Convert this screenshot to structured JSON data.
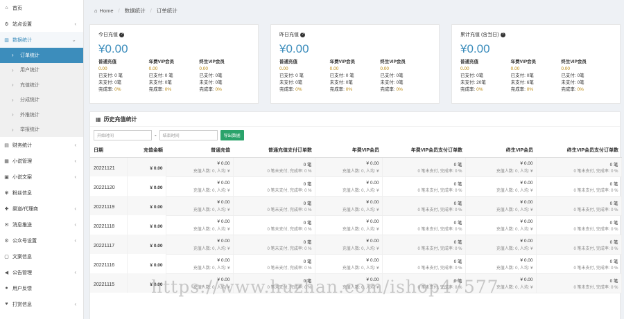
{
  "sidebar": {
    "items": [
      {
        "icon": "house-icon",
        "glyph": "⌂",
        "label": "首页",
        "arrow": ""
      },
      {
        "icon": "gear-icon",
        "glyph": "⚙",
        "label": "站点设置",
        "arrow": "‹"
      },
      {
        "icon": "bar-chart-icon",
        "glyph": "▥",
        "label": "数据统计",
        "arrow": "⌄",
        "active": true
      }
    ],
    "sub_items": [
      {
        "label": "订单统计",
        "active": true
      },
      {
        "label": "用户统计"
      },
      {
        "label": "充值统计"
      },
      {
        "label": "分成统计"
      },
      {
        "label": "外推统计"
      },
      {
        "label": "举报统计"
      }
    ],
    "items_after": [
      {
        "icon": "finance-icon",
        "glyph": "▤",
        "label": "财务统计",
        "arrow": "‹"
      },
      {
        "icon": "book-icon",
        "glyph": "▦",
        "label": "小说管理",
        "arrow": "‹"
      },
      {
        "icon": "document-icon",
        "glyph": "▣",
        "label": "小说文案",
        "arrow": "‹"
      },
      {
        "icon": "fans-icon",
        "glyph": "✾",
        "label": "粉丝信息",
        "arrow": ""
      },
      {
        "icon": "user-plus-icon",
        "glyph": "✚",
        "label": "渠道/代理商",
        "arrow": "‹"
      },
      {
        "icon": "chat-icon",
        "glyph": "✉",
        "label": "消息推送",
        "arrow": "‹"
      },
      {
        "icon": "gears-icon",
        "glyph": "⚙",
        "label": "公众号设置",
        "arrow": "‹"
      },
      {
        "icon": "file-icon",
        "glyph": "▢",
        "label": "文案信息",
        "arrow": ""
      },
      {
        "icon": "megaphone-icon",
        "glyph": "◀",
        "label": "公告管理",
        "arrow": "‹"
      },
      {
        "icon": "comment-icon",
        "glyph": "●",
        "label": "用户反馈",
        "arrow": ""
      },
      {
        "icon": "tag-icon",
        "glyph": "♥",
        "label": "打赏信息",
        "arrow": "‹"
      }
    ]
  },
  "breadcrumb": {
    "home": "Home",
    "level1": "数据统计",
    "level2": "订单统计"
  },
  "stat_cards": [
    {
      "title": "今日充值",
      "amount": "¥0.00",
      "cols": [
        {
          "head": "普通充值",
          "value": "0.00",
          "paid": "已支付: 0 笔",
          "unpaid": "未支付: 0笔",
          "rate_label": "完成率:",
          "rate": "0%"
        },
        {
          "head": "年费VIP会员",
          "value": "0.00",
          "paid": "已支付: 0 笔",
          "unpaid": "未支付: 0笔",
          "rate_label": "完成率:",
          "rate": "0%"
        },
        {
          "head": "终生VIP会员",
          "value": "0.00",
          "paid": "已支付: 0笔",
          "unpaid": "未支付: 0笔",
          "rate_label": "完成率:",
          "rate": "0%"
        }
      ]
    },
    {
      "title": "昨日充值",
      "amount": "¥0.00",
      "cols": [
        {
          "head": "普通充值",
          "value": "0.00",
          "paid": "已支付: 0 笔",
          "unpaid": "未支付: 0笔",
          "rate_label": "完成率:",
          "rate": "0%"
        },
        {
          "head": "年费VIP会员",
          "value": "0.00",
          "paid": "已支付: 0 笔",
          "unpaid": "未支付: 0笔",
          "rate_label": "完成率:",
          "rate": "0%"
        },
        {
          "head": "终生VIP会员",
          "value": "0.00",
          "paid": "已支付: 0笔",
          "unpaid": "未支付: 0笔",
          "rate_label": "完成率:",
          "rate": "0%"
        }
      ]
    },
    {
      "title": "累计充值 (含当日)",
      "amount": "¥0.00",
      "cols": [
        {
          "head": "普通充值",
          "value": "0.00",
          "paid": "已支付: 0笔",
          "unpaid": "未支付: 20笔",
          "rate_label": "完成率:",
          "rate": "0%"
        },
        {
          "head": "年费VIP会员",
          "value": "0.00",
          "paid": "已支付: 0笔",
          "unpaid": "未支付: 6笔",
          "rate_label": "完成率:",
          "rate": "0%"
        },
        {
          "head": "终生VIP会员",
          "value": "0.00",
          "paid": "已支付: 0笔",
          "unpaid": "未支付: 0笔",
          "rate_label": "完成率:",
          "rate": "0%"
        }
      ]
    }
  ],
  "history": {
    "title": "历史充值统计",
    "start_placeholder": "开始时间",
    "end_placeholder": "结束时间",
    "dash": "-",
    "export_label": "导出数据",
    "columns": [
      "日期",
      "充值金额",
      "普通充值",
      "普通充值支付订单数",
      "年费VIP会员",
      "年费VIP会员支付订单数",
      "终生VIP会员",
      "终生VIP会员支付订单数"
    ],
    "rows": [
      {
        "date": "20221121",
        "total": "¥ 0.00",
        "normal": "¥ 0.00",
        "normal_sub": "充值人数: 0, 人均: ¥",
        "normal_orders": "0 笔",
        "normal_orders_sub": "0 笔未支付, 完成率: 0 %",
        "yearly": "¥ 0.00",
        "yearly_sub": "充值人数: 0, 人均: ¥",
        "yearly_orders": "0 笔",
        "yearly_orders_sub": "0 笔未支付, 完成率: 0 %",
        "life": "¥ 0.00",
        "life_sub": "充值人数: 0, 人均: ¥",
        "life_orders": "0 笔",
        "life_orders_sub": "0 笔未支付, 完成率: 0 %"
      },
      {
        "date": "20221120",
        "total": "¥ 0.00",
        "normal": "¥ 0.00",
        "normal_sub": "充值人数: 0, 人均: ¥",
        "normal_orders": "0 笔",
        "normal_orders_sub": "0 笔未支付, 完成率: 0 %",
        "yearly": "¥ 0.00",
        "yearly_sub": "充值人数: 0, 人均: ¥",
        "yearly_orders": "0 笔",
        "yearly_orders_sub": "0 笔未支付, 完成率: 0 %",
        "life": "¥ 0.00",
        "life_sub": "充值人数: 0, 人均: ¥",
        "life_orders": "0 笔",
        "life_orders_sub": "0 笔未支付, 完成率: 0 %"
      },
      {
        "date": "20221119",
        "total": "¥ 0.00",
        "normal": "¥ 0.00",
        "normal_sub": "充值人数: 0, 人均: ¥",
        "normal_orders": "0 笔",
        "normal_orders_sub": "0 笔未支付, 完成率: 0 %",
        "yearly": "¥ 0.00",
        "yearly_sub": "充值人数: 0, 人均: ¥",
        "yearly_orders": "0 笔",
        "yearly_orders_sub": "0 笔未支付, 完成率: 0 %",
        "life": "¥ 0.00",
        "life_sub": "充值人数: 0, 人均: ¥",
        "life_orders": "0 笔",
        "life_orders_sub": "0 笔未支付, 完成率: 0 %"
      },
      {
        "date": "20221118",
        "total": "¥ 0.00",
        "normal": "¥ 0.00",
        "normal_sub": "充值人数: 0, 人均: ¥",
        "normal_orders": "0 笔",
        "normal_orders_sub": "0 笔未支付, 完成率: 0 %",
        "yearly": "¥ 0.00",
        "yearly_sub": "充值人数: 0, 人均: ¥",
        "yearly_orders": "0 笔",
        "yearly_orders_sub": "0 笔未支付, 完成率: 0 %",
        "life": "¥ 0.00",
        "life_sub": "充值人数: 0, 人均: ¥",
        "life_orders": "0 笔",
        "life_orders_sub": "0 笔未支付, 完成率: 0 %"
      },
      {
        "date": "20221117",
        "total": "¥ 0.00",
        "normal": "¥ 0.00",
        "normal_sub": "充值人数: 0, 人均: ¥",
        "normal_orders": "0 笔",
        "normal_orders_sub": "0 笔未支付, 完成率: 0 %",
        "yearly": "¥ 0.00",
        "yearly_sub": "充值人数: 0, 人均: ¥",
        "yearly_orders": "0 笔",
        "yearly_orders_sub": "0 笔未支付, 完成率: 0 %",
        "life": "¥ 0.00",
        "life_sub": "充值人数: 0, 人均: ¥",
        "life_orders": "0 笔",
        "life_orders_sub": "0 笔未支付, 完成率: 0 %"
      },
      {
        "date": "20221116",
        "total": "¥ 0.00",
        "normal": "¥ 0.00",
        "normal_sub": "充值人数: 0, 人均: ¥",
        "normal_orders": "0 笔",
        "normal_orders_sub": "0 笔未支付, 完成率: 0 %",
        "yearly": "¥ 0.00",
        "yearly_sub": "充值人数: 0, 人均: ¥",
        "yearly_orders": "0 笔",
        "yearly_orders_sub": "0 笔未支付, 完成率: 0 %",
        "life": "¥ 0.00",
        "life_sub": "充值人数: 0, 人均: ¥",
        "life_orders": "0 笔",
        "life_orders_sub": "0 笔未支付, 完成率: 0 %"
      },
      {
        "date": "20221115",
        "total": "¥ 0.00",
        "normal": "¥ 0.00",
        "normal_sub": "充值人数: 0, 人均: ¥",
        "normal_orders": "0 笔",
        "normal_orders_sub": "0 笔未支付, 完成率: 0 %",
        "yearly": "¥ 0.00",
        "yearly_sub": "充值人数: 0, 人均: ¥",
        "yearly_orders": "0 笔",
        "yearly_orders_sub": "0 笔未支付, 完成率: 0 %",
        "life": "¥ 0.00",
        "life_sub": "充值人数: 0, 人均: ¥",
        "life_orders": "0 笔",
        "life_orders_sub": "0 笔未支付, 完成率: 0 %"
      }
    ]
  },
  "watermark": "https://www.huzhan.com/ishop47577",
  "colors": {
    "accent": "#3c8dbc",
    "export_button": "#2aa36b",
    "value_gold": "#b8860b"
  }
}
